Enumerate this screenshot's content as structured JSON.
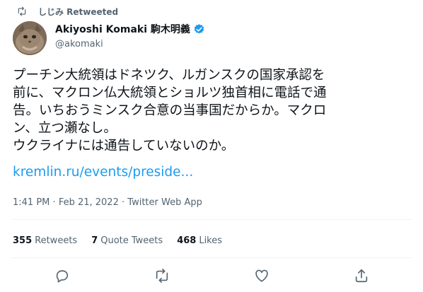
{
  "retweet_context": {
    "label": "しじみ Retweeted",
    "icon": "retweet-icon"
  },
  "author": {
    "display_name": "Akiyoshi Komaki 駒木明義",
    "handle": "@akomaki",
    "verified_icon": "verified-badge-icon",
    "avatar_icon": "cat-avatar"
  },
  "tweet": {
    "text": "プーチン大統領はドネツク、ルガンスクの国家承認を\n前に、マクロン仏大統領とショルツ独首相に電話で通\n告。いちおうミンスク合意の当事国だからか。マクロ\nン、立つ瀬なし。\nウクライナには通告していないのか。",
    "link": "kremlin.ru/events/preside..."
  },
  "meta": {
    "time": "1:41 PM",
    "separator": "·",
    "date": "Feb 21, 2022",
    "source": "Twitter Web App"
  },
  "stats": {
    "retweets_count": "355",
    "retweets_label": "Retweets",
    "quotes_count": "7",
    "quotes_label": "Quote Tweets",
    "likes_count": "468",
    "likes_label": "Likes"
  },
  "actions": [
    "reply-icon",
    "retweet-icon",
    "like-icon",
    "share-icon"
  ],
  "colors": {
    "link": "#1d9bf0",
    "secondary": "#536471",
    "text": "#0f1419",
    "divider": "#eff3f4"
  }
}
